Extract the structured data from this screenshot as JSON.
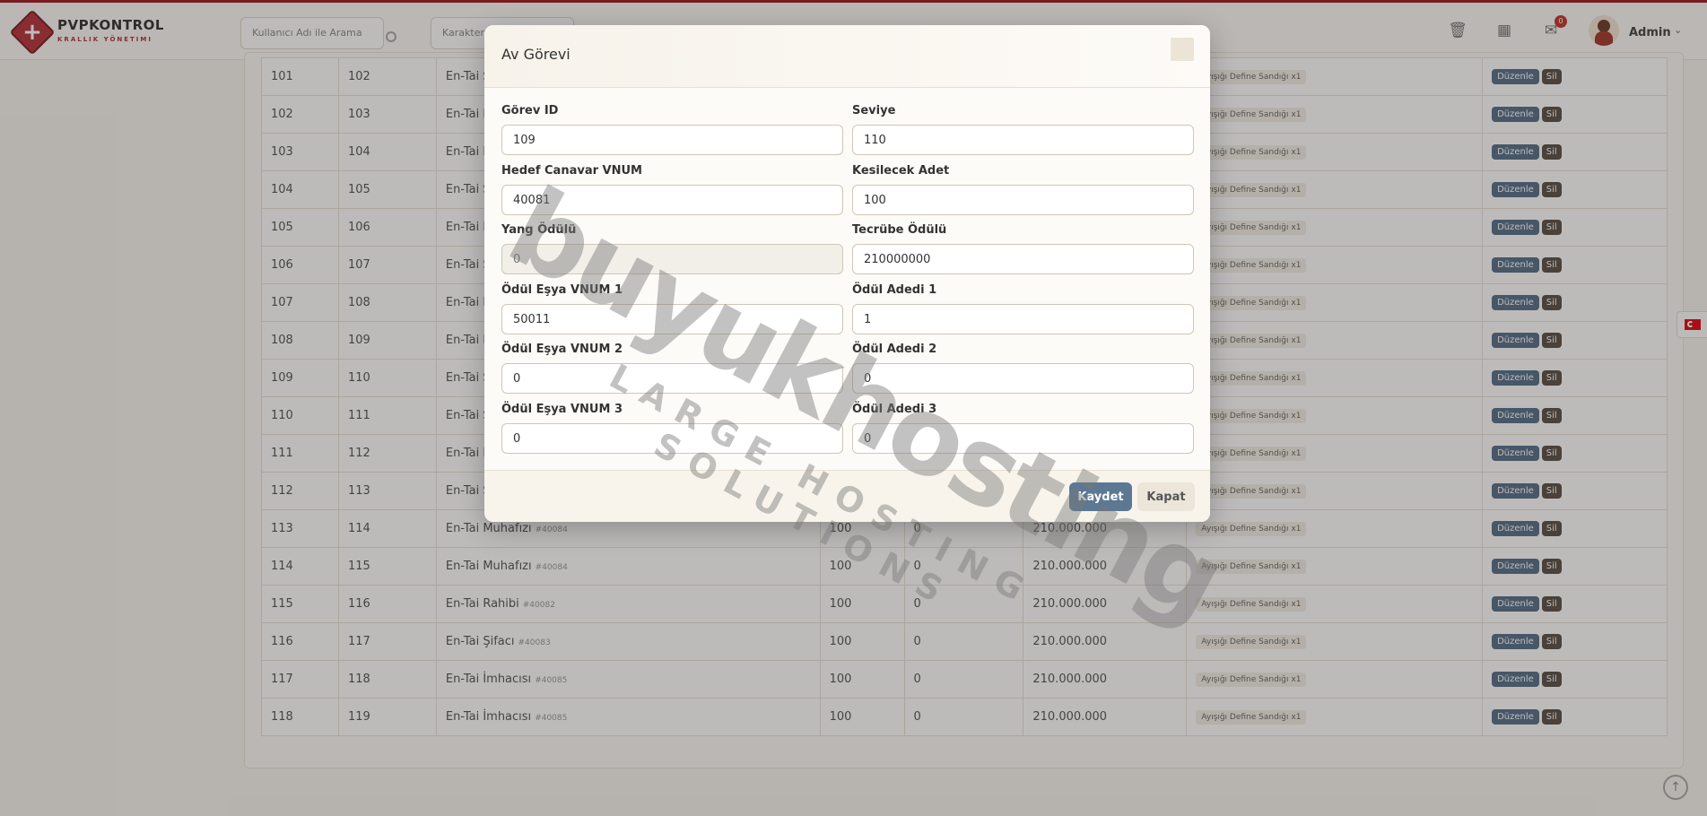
{
  "brand": {
    "name": "PVPKONTROL",
    "subtitle": "KRALLIK YÖNETIMI"
  },
  "header": {
    "search_user_placeholder": "Kullanıcı Adı ile Arama",
    "search_char_placeholder": "Karakter",
    "notification_count": "0",
    "admin_name": "Admin"
  },
  "table": {
    "rows": [
      {
        "id": "101",
        "quest": "102",
        "mob": "En-Tai Ş",
        "vnum": "",
        "level": "",
        "yang": "",
        "exp": "",
        "reward": "Ayışığı Define Sandığı x1"
      },
      {
        "id": "102",
        "quest": "103",
        "mob": "En-Tai M",
        "vnum": "",
        "level": "",
        "yang": "",
        "exp": "",
        "reward": "Ayışığı Define Sandığı x1"
      },
      {
        "id": "103",
        "quest": "104",
        "mob": "En-Tai I",
        "vnum": "",
        "level": "",
        "yang": "",
        "exp": "",
        "reward": "Ayışığı Define Sandığı x1"
      },
      {
        "id": "104",
        "quest": "105",
        "mob": "En-Tai Ş",
        "vnum": "",
        "level": "",
        "yang": "",
        "exp": "",
        "reward": "Ayışığı Define Sandığı x1"
      },
      {
        "id": "105",
        "quest": "106",
        "mob": "En-Tai R",
        "vnum": "",
        "level": "",
        "yang": "",
        "exp": "",
        "reward": "Ayışığı Define Sandığı x1"
      },
      {
        "id": "106",
        "quest": "107",
        "mob": "En-Tai Ş",
        "vnum": "",
        "level": "",
        "yang": "",
        "exp": "",
        "reward": "Ayışığı Define Sandığı x1"
      },
      {
        "id": "107",
        "quest": "108",
        "mob": "En-Tai M",
        "vnum": "",
        "level": "",
        "yang": "",
        "exp": "",
        "reward": "Ayışığı Define Sandığı x1"
      },
      {
        "id": "108",
        "quest": "109",
        "mob": "En-Tai I",
        "vnum": "",
        "level": "",
        "yang": "",
        "exp": "",
        "reward": "Ayışığı Define Sandığı x1"
      },
      {
        "id": "109",
        "quest": "110",
        "mob": "En-Tai Ş",
        "vnum": "",
        "level": "",
        "yang": "",
        "exp": "",
        "reward": "Ayışığı Define Sandığı x1"
      },
      {
        "id": "110",
        "quest": "111",
        "mob": "En-Tai Ş",
        "vnum": "",
        "level": "",
        "yang": "",
        "exp": "",
        "reward": "Ayışığı Define Sandığı x1"
      },
      {
        "id": "111",
        "quest": "112",
        "mob": "En-Tai R",
        "vnum": "",
        "level": "",
        "yang": "",
        "exp": "",
        "reward": "Ayışığı Define Sandığı x1"
      },
      {
        "id": "112",
        "quest": "113",
        "mob": "En-Tai Ş",
        "vnum": "",
        "level": "",
        "yang": "",
        "exp": "",
        "reward": "Ayışığı Define Sandığı x1"
      },
      {
        "id": "113",
        "quest": "114",
        "mob": "En-Tai Muhafızı",
        "vnum": "#40084",
        "level": "100",
        "yang": "0",
        "exp": "210.000.000",
        "reward": "Ayışığı Define Sandığı x1"
      },
      {
        "id": "114",
        "quest": "115",
        "mob": "En-Tai Muhafızı",
        "vnum": "#40084",
        "level": "100",
        "yang": "0",
        "exp": "210.000.000",
        "reward": "Ayışığı Define Sandığı x1"
      },
      {
        "id": "115",
        "quest": "116",
        "mob": "En-Tai Rahibi",
        "vnum": "#40082",
        "level": "100",
        "yang": "0",
        "exp": "210.000.000",
        "reward": "Ayışığı Define Sandığı x1"
      },
      {
        "id": "116",
        "quest": "117",
        "mob": "En-Tai Şifacı",
        "vnum": "#40083",
        "level": "100",
        "yang": "0",
        "exp": "210.000.000",
        "reward": "Ayışığı Define Sandığı x1"
      },
      {
        "id": "117",
        "quest": "118",
        "mob": "En-Tai İmhacısı",
        "vnum": "#40085",
        "level": "100",
        "yang": "0",
        "exp": "210.000.000",
        "reward": "Ayışığı Define Sandığı x1"
      },
      {
        "id": "118",
        "quest": "119",
        "mob": "En-Tai İmhacısı",
        "vnum": "#40085",
        "level": "100",
        "yang": "0",
        "exp": "210.000.000",
        "reward": "Ayışığı Define Sandığı x1"
      }
    ],
    "edit_label": "Düzenle",
    "delete_label": "Sil"
  },
  "modal": {
    "title": "Av Görevi",
    "fields": {
      "gorev_id": {
        "label": "Görev ID",
        "value": "109"
      },
      "seviye": {
        "label": "Seviye",
        "value": "110"
      },
      "hedef_vnum": {
        "label": "Hedef Canavar VNUM",
        "value": "40081"
      },
      "kesilecek_adet": {
        "label": "Kesilecek Adet",
        "value": "100"
      },
      "yang_odulu": {
        "label": "Yang Ödülü",
        "value": "0"
      },
      "tecrube_odulu": {
        "label": "Tecrübe Ödülü",
        "value": "210000000"
      },
      "esya_vnum_1": {
        "label": "Ödül Eşya VNUM 1",
        "value": "50011"
      },
      "odul_adedi_1": {
        "label": "Ödül Adedi 1",
        "value": "1"
      },
      "esya_vnum_2": {
        "label": "Ödül Eşya VNUM 2",
        "value": "0"
      },
      "odul_adedi_2": {
        "label": "Ödül Adedi 2",
        "value": "0"
      },
      "esya_vnum_3": {
        "label": "Ödül Eşya VNUM 3",
        "value": "0"
      },
      "odul_adedi_3": {
        "label": "Ödül Adedi 3",
        "value": "0"
      }
    },
    "save_label": "Kaydet",
    "close_label": "Kapat"
  },
  "watermark": {
    "main": "buyukhosting",
    "sub": "LARGE HOSTING SOLUTIONS"
  },
  "icons": {
    "trash": "trash-icon",
    "calendar": "calendar-icon",
    "mail": "mail-icon",
    "chevron": "chevron-down-icon",
    "search": "search-icon",
    "flag": "turkey-flag-icon",
    "scroll_up": "arrow-up-icon"
  },
  "colors": {
    "accent_red": "#9c1b24",
    "primary_button": "#5c7893",
    "edit_button": "#57708a",
    "delete_button": "#5a5148"
  }
}
